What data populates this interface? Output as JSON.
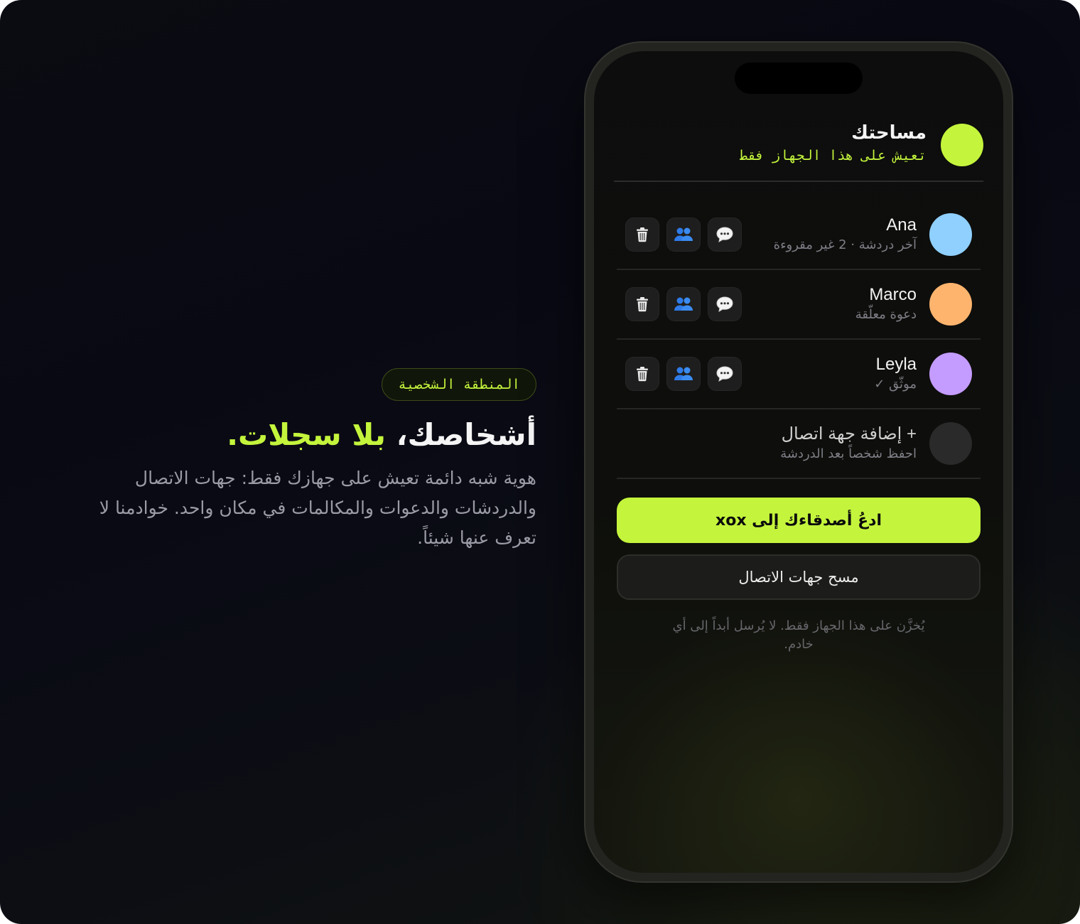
{
  "hero": {
    "tag": "المنطقة الشخصية",
    "headline_main": "أشخاصك، ",
    "headline_accent": "بلا سجلات",
    "headline_end": ".",
    "description": "هوية شبه دائمة تعيش على جهازك فقط: جهات الاتصال والدردشات والدعوات والمكالمات في مكان واحد. خوادمنا لا تعرف عنها شيئاً."
  },
  "space": {
    "title": "مساحتك",
    "subtitle": "تعيش على هذا الجهاز فقط"
  },
  "contacts": [
    {
      "name": "Ana",
      "status": "آخر دردشة · 2 غير مقروءة",
      "color": "#8fd0ff"
    },
    {
      "name": "Marco",
      "status": "دعوة معلّقة",
      "color": "#ffb46e"
    },
    {
      "name": "Leyla",
      "status": "موثّق ✓",
      "color": "#c49bff"
    }
  ],
  "add_contact": {
    "label": "+ إضافة جهة اتصال",
    "hint": "احفظ شخصاً بعد الدردشة",
    "color": "#2a2a2a"
  },
  "icons": {
    "chat": "speech-bubble-icon",
    "group": "people-icon",
    "delete": "trash-icon"
  },
  "buttons": {
    "invite": "ادعُ أصدقاءك إلى xox",
    "clear": "مسح جهات الاتصال"
  },
  "footer_note": "يُخزَّن على هذا الجهاز فقط. لا يُرسل أبداً إلى أي خادم.",
  "colors": {
    "accent": "#c4f53c",
    "background": "#0a0a12"
  }
}
